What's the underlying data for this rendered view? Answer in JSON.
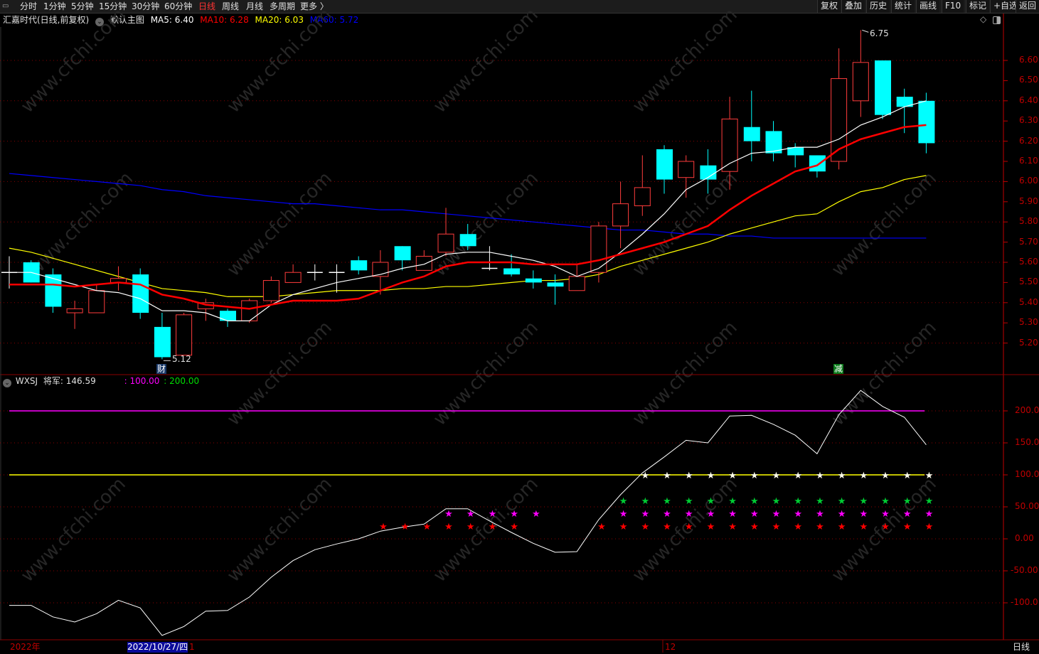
{
  "toolbar": {
    "left_items": [
      {
        "label": "分时",
        "active": false
      },
      {
        "label": "1分钟",
        "active": false
      },
      {
        "label": "5分钟",
        "active": false
      },
      {
        "label": "15分钟",
        "active": false
      },
      {
        "label": "30分钟",
        "active": false
      },
      {
        "label": "60分钟",
        "active": false
      },
      {
        "label": "日线",
        "active": true
      },
      {
        "label": "周线",
        "active": false
      },
      {
        "label": "月线",
        "active": false
      },
      {
        "label": "多周期",
        "active": false
      },
      {
        "label": "更多 〉",
        "active": false
      }
    ],
    "right_buttons": [
      "复权",
      "叠加",
      "历史",
      "统计",
      "画线",
      "F10",
      "标记",
      "+自选",
      "返回"
    ]
  },
  "header": {
    "stock": "汇嘉时代(日线,前复权)",
    "main_chart": "默认主图",
    "ma5": "MA5: 6.40",
    "ma10": "MA10: 6.28",
    "ma20": "MA20: 6.03",
    "ma60": "MA60: 5.72"
  },
  "colors": {
    "up": "#ff3c3c",
    "down": "#00ffff",
    "ma5": "#ffffff",
    "ma10": "#ff0000",
    "ma20": "#ffff00",
    "ma60": "#0000ff",
    "grid": "#8b0000",
    "axis": "#c00000"
  },
  "price_axis": {
    "labels": [
      "6.60",
      "6.50",
      "6.40",
      "6.30",
      "6.20",
      "6.10",
      "6.00",
      "5.90",
      "5.80",
      "5.70",
      "5.60",
      "5.50",
      "5.40",
      "5.30",
      "5.20"
    ]
  },
  "annotations": {
    "high": "6.75",
    "low": "5.12",
    "tag_cai": "财",
    "tag_jian": "减"
  },
  "candles": [
    [
      5.55,
      5.55,
      5.63,
      5.47
    ],
    [
      5.6,
      5.5,
      5.61,
      5.5
    ],
    [
      5.54,
      5.38,
      5.57,
      5.35
    ],
    [
      5.35,
      5.37,
      5.41,
      5.27
    ],
    [
      5.35,
      5.46,
      5.49,
      5.35
    ],
    [
      5.5,
      5.52,
      5.58,
      5.46
    ],
    [
      5.54,
      5.35,
      5.57,
      5.32
    ],
    [
      5.28,
      5.13,
      5.35,
      5.12
    ],
    [
      5.14,
      5.34,
      5.35,
      5.14
    ],
    [
      5.37,
      5.4,
      5.42,
      5.31
    ],
    [
      5.36,
      5.31,
      5.37,
      5.28
    ],
    [
      5.31,
      5.41,
      5.42,
      5.3
    ],
    [
      5.41,
      5.51,
      5.53,
      5.4
    ],
    [
      5.5,
      5.55,
      5.59,
      5.5
    ],
    [
      5.55,
      5.55,
      5.59,
      5.51
    ],
    [
      5.55,
      5.55,
      5.59,
      5.45
    ],
    [
      5.61,
      5.56,
      5.63,
      5.54
    ],
    [
      5.53,
      5.6,
      5.66,
      5.44
    ],
    [
      5.68,
      5.61,
      5.68,
      5.56
    ],
    [
      5.56,
      5.63,
      5.66,
      5.56
    ],
    [
      5.65,
      5.74,
      5.87,
      5.63
    ],
    [
      5.74,
      5.68,
      5.79,
      5.66
    ],
    [
      5.57,
      5.57,
      5.68,
      5.56
    ],
    [
      5.57,
      5.54,
      5.64,
      5.53
    ],
    [
      5.52,
      5.5,
      5.56,
      5.47
    ],
    [
      5.5,
      5.48,
      5.54,
      5.39
    ],
    [
      5.46,
      5.53,
      5.59,
      5.46
    ],
    [
      5.55,
      5.78,
      5.8,
      5.5
    ],
    [
      5.78,
      5.89,
      6.0,
      5.67
    ],
    [
      5.88,
      5.97,
      6.13,
      5.83
    ],
    [
      6.16,
      6.01,
      6.18,
      5.94
    ],
    [
      6.02,
      6.1,
      6.13,
      5.92
    ],
    [
      6.08,
      6.01,
      6.16,
      5.94
    ],
    [
      6.05,
      6.31,
      6.42,
      5.96
    ],
    [
      6.27,
      6.2,
      6.45,
      6.1
    ],
    [
      6.25,
      6.14,
      6.3,
      6.1
    ],
    [
      6.17,
      6.13,
      6.19,
      6.07
    ],
    [
      6.13,
      6.05,
      6.13,
      6.02
    ],
    [
      6.1,
      6.51,
      6.66,
      6.06
    ],
    [
      6.4,
      6.59,
      6.75,
      6.32
    ],
    [
      6.6,
      6.33,
      6.6,
      6.31
    ],
    [
      6.42,
      6.37,
      6.46,
      6.24
    ],
    [
      6.4,
      6.19,
      6.44,
      6.14
    ]
  ],
  "ma": {
    "ma5": [
      5.55,
      5.55,
      5.52,
      5.49,
      5.46,
      5.45,
      5.42,
      5.36,
      5.36,
      5.35,
      5.31,
      5.31,
      5.39,
      5.44,
      5.47,
      5.5,
      5.52,
      5.54,
      5.57,
      5.59,
      5.64,
      5.65,
      5.65,
      5.63,
      5.61,
      5.58,
      5.53,
      5.57,
      5.65,
      5.74,
      5.84,
      5.96,
      6.02,
      6.09,
      6.14,
      6.15,
      6.17,
      6.17,
      6.21,
      6.28,
      6.32,
      6.37,
      6.4
    ],
    "ma10": [
      5.49,
      5.49,
      5.49,
      5.48,
      5.49,
      5.5,
      5.49,
      5.44,
      5.42,
      5.39,
      5.38,
      5.37,
      5.39,
      5.41,
      5.41,
      5.41,
      5.42,
      5.46,
      5.5,
      5.53,
      5.58,
      5.6,
      5.6,
      5.6,
      5.59,
      5.59,
      5.59,
      5.61,
      5.64,
      5.67,
      5.7,
      5.74,
      5.78,
      5.86,
      5.93,
      5.99,
      6.05,
      6.08,
      6.16,
      6.21,
      6.24,
      6.27,
      6.28
    ],
    "ma20": [
      5.67,
      5.65,
      5.62,
      5.59,
      5.56,
      5.53,
      5.5,
      5.47,
      5.46,
      5.45,
      5.43,
      5.43,
      5.43,
      5.44,
      5.45,
      5.46,
      5.46,
      5.46,
      5.47,
      5.47,
      5.48,
      5.48,
      5.49,
      5.5,
      5.51,
      5.51,
      5.52,
      5.54,
      5.58,
      5.61,
      5.64,
      5.67,
      5.7,
      5.74,
      5.77,
      5.8,
      5.83,
      5.84,
      5.9,
      5.95,
      5.97,
      6.01,
      6.03
    ],
    "ma60": [
      6.04,
      6.03,
      6.02,
      6.01,
      6.0,
      5.99,
      5.98,
      5.96,
      5.95,
      5.93,
      5.92,
      5.91,
      5.9,
      5.89,
      5.89,
      5.88,
      5.87,
      5.86,
      5.86,
      5.85,
      5.84,
      5.83,
      5.82,
      5.81,
      5.8,
      5.79,
      5.78,
      5.77,
      5.76,
      5.76,
      5.75,
      5.74,
      5.74,
      5.73,
      5.73,
      5.72,
      5.72,
      5.72,
      5.72,
      5.72,
      5.72,
      5.72,
      5.72
    ]
  },
  "indicator": {
    "name": "WXSJ",
    "value_label": "将军: 146.59",
    "line1_label": ": 100.00",
    "line2_label": ": 200.00",
    "line1_color": "#ff00ff",
    "line2_color": "#00dd00",
    "axis_labels": [
      "200.0",
      "150.0",
      "100.0",
      "50.00",
      "0.00",
      "-50.00",
      "-100.0"
    ],
    "values": [
      -104,
      -104,
      -122,
      -130,
      -117,
      -96,
      -108,
      -151,
      -137,
      -113,
      -112,
      -91,
      -60,
      -34,
      -17,
      -8,
      0,
      12,
      18,
      23,
      47,
      47,
      28,
      10,
      -7,
      -21,
      -20,
      30,
      69,
      103,
      128,
      154,
      150,
      192,
      193,
      179,
      162,
      133,
      194,
      232,
      207,
      190,
      147
    ],
    "star_rows": [
      {
        "level": 20,
        "color": "#ff0000",
        "indices": [
          17,
          18,
          19,
          20,
          21,
          22,
          23,
          27,
          28,
          29,
          30,
          31,
          32,
          33,
          34,
          35,
          36,
          37,
          38,
          39,
          40,
          41,
          42
        ]
      },
      {
        "level": 40,
        "color": "#ff00ff",
        "indices": [
          20,
          21,
          22,
          23,
          24,
          28,
          29,
          30,
          31,
          32,
          33,
          34,
          35,
          36,
          37,
          38,
          39,
          40,
          41,
          42
        ]
      },
      {
        "level": 60,
        "color": "#00cc33",
        "indices": [
          28,
          29,
          30,
          31,
          32,
          33,
          34,
          35,
          36,
          37,
          38,
          39,
          40,
          41,
          42
        ]
      },
      {
        "level": 100,
        "color": "#ffffee",
        "indices": [
          29,
          30,
          31,
          32,
          33,
          34,
          35,
          36,
          37,
          38,
          39,
          40,
          41,
          42
        ]
      }
    ]
  },
  "time_axis": {
    "year": "2022年",
    "cursor_date": "2022/10/27/四",
    "mark1": "1",
    "mark12": "12",
    "period": "日线"
  },
  "watermark": "www.cfchi.com"
}
